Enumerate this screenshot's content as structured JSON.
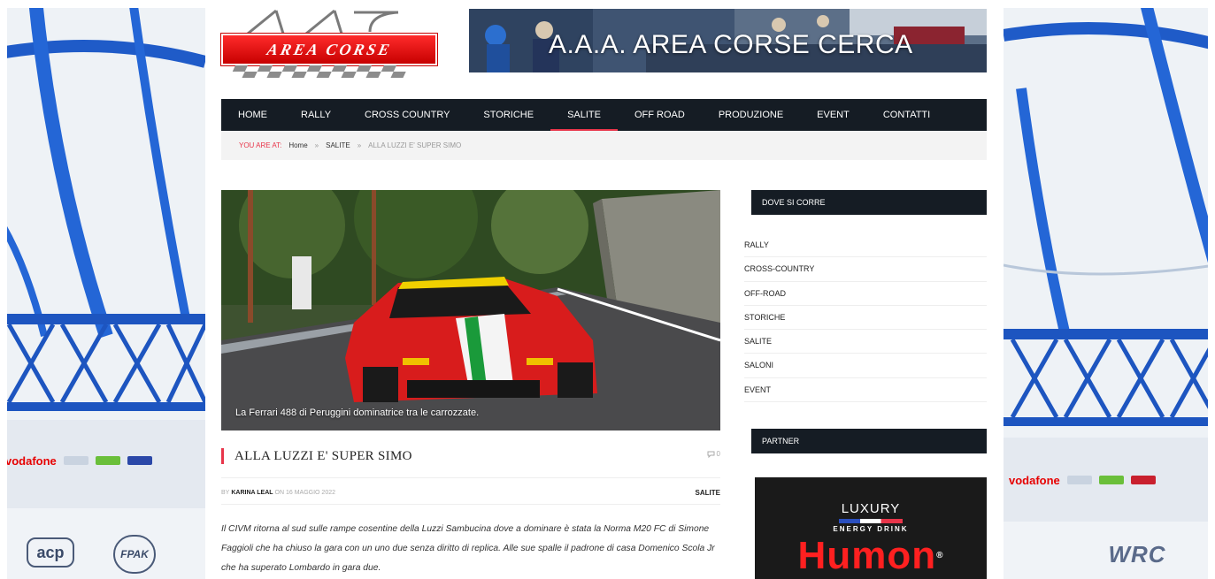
{
  "header": {
    "logo_text": "AREA CORSE",
    "banner_text": "A.A.A. AREA CORSE CERCA"
  },
  "nav": {
    "items": [
      {
        "label": "HOME"
      },
      {
        "label": "RALLY"
      },
      {
        "label": "CROSS COUNTRY"
      },
      {
        "label": "STORICHE"
      },
      {
        "label": "SALITE",
        "active": true
      },
      {
        "label": "OFF ROAD"
      },
      {
        "label": "PRODUZIONE"
      },
      {
        "label": "EVENT"
      },
      {
        "label": "CONTATTI"
      }
    ]
  },
  "breadcrumb": {
    "label": "YOU ARE AT:",
    "home": "Home",
    "separator": "»",
    "section": "SALITE",
    "current": "ALLA LUZZI E' SUPER SIMO"
  },
  "article": {
    "image_caption": "La Ferrari 488 di Peruggini dominatrice tra le carrozzate.",
    "title": "ALLA LUZZI E' SUPER SIMO",
    "comments": "0",
    "by_label": "BY",
    "author": "KARINA LEAL",
    "date": "ON 16 MAGGIO 2022",
    "category": "SALITE",
    "body": "Il CIVM ritorna al sud sulle rampe cosentine della Luzzi Sambucina dove a dominare è stata la Norma M20 FC di Simone Faggioli che ha chiuso la gara con un uno due senza diritto di replica. Alle sue spalle il padrone di casa Domenico Scola Jr che ha superato Lombardo in gara due."
  },
  "sidebar": {
    "widget_title": "DOVE SI CORRE",
    "links": [
      {
        "label": "RALLY"
      },
      {
        "label": "CROSS-COUNTRY"
      },
      {
        "label": "OFF-ROAD"
      },
      {
        "label": "STORICHE"
      },
      {
        "label": "SALITE"
      },
      {
        "label": "SALONI"
      },
      {
        "label": "EVENT"
      }
    ],
    "partner_title": "PARTNER",
    "ad": {
      "line1": "LUXURY",
      "line2": "ENERGY DRINK",
      "brand": "Humon",
      "reg": "®"
    }
  },
  "background": {
    "left_sponsor": "vodafone",
    "left_logo_1": "acp",
    "left_logo_2": "FPAK",
    "right_sponsor": "vodafone",
    "right_logo": "WRC"
  },
  "colors": {
    "nav_bg": "#151c24",
    "accent": "#e8354a",
    "logo_red": "#e00000"
  }
}
